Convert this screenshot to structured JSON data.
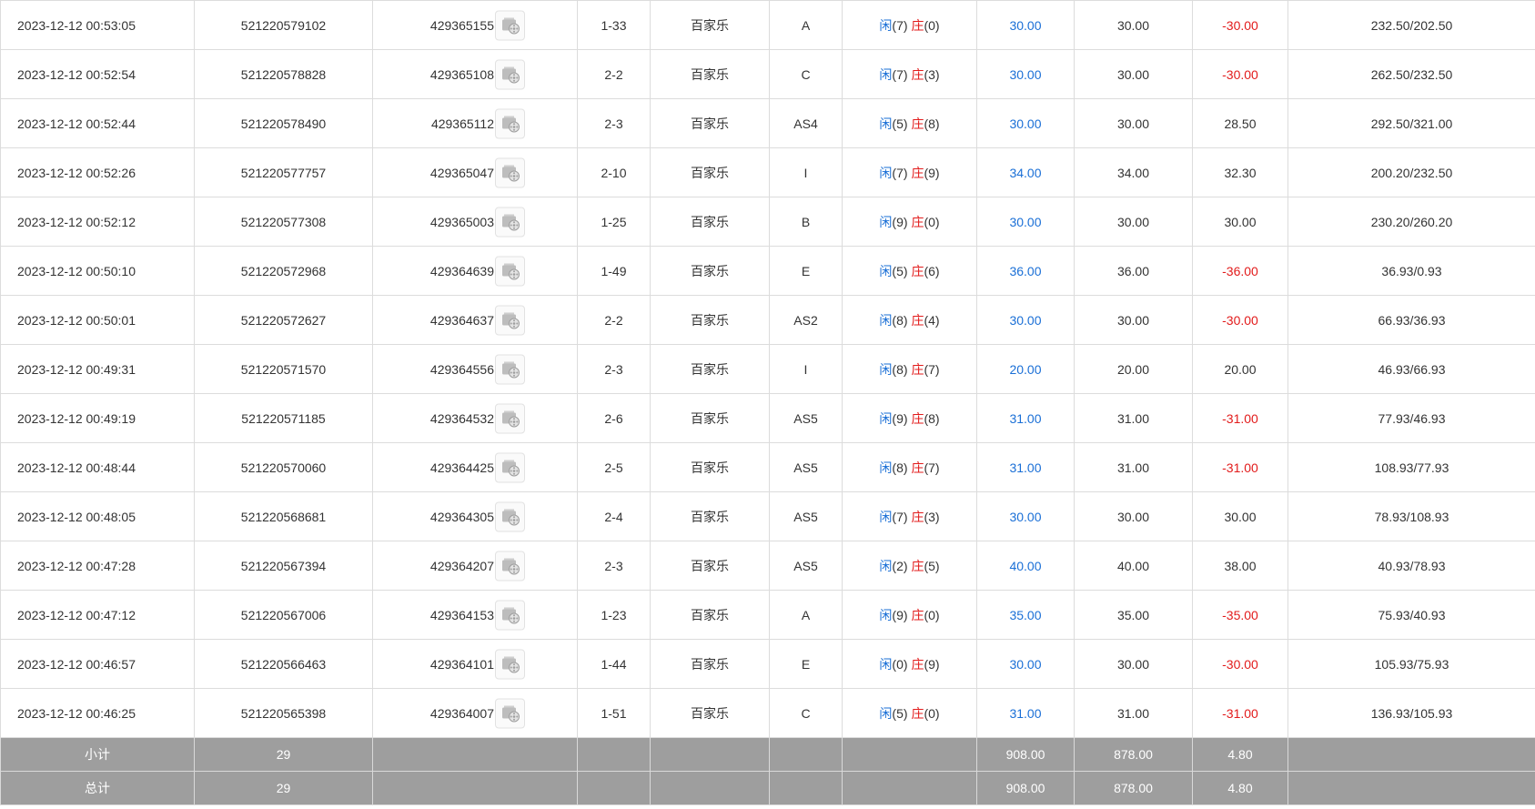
{
  "colors": {
    "blue": "#1a6fd6",
    "red": "#e21b1b",
    "summary_bg": "#9e9e9e"
  },
  "labels": {
    "player": "闲",
    "banker": "庄"
  },
  "rows": [
    {
      "time": "2023-12-12 00:53:05",
      "order": "521220579102",
      "round": "429365155",
      "shoe": "1-33",
      "game": "百家乐",
      "table": "A",
      "player": "7",
      "banker": "0",
      "bet": "30.00",
      "valid": "30.00",
      "win": "-30.00",
      "balance": "232.50/202.50"
    },
    {
      "time": "2023-12-12 00:52:54",
      "order": "521220578828",
      "round": "429365108",
      "shoe": "2-2",
      "game": "百家乐",
      "table": "C",
      "player": "7",
      "banker": "3",
      "bet": "30.00",
      "valid": "30.00",
      "win": "-30.00",
      "balance": "262.50/232.50"
    },
    {
      "time": "2023-12-12 00:52:44",
      "order": "521220578490",
      "round": "429365112",
      "shoe": "2-3",
      "game": "百家乐",
      "table": "AS4",
      "player": "5",
      "banker": "8",
      "bet": "30.00",
      "valid": "30.00",
      "win": "28.50",
      "balance": "292.50/321.00"
    },
    {
      "time": "2023-12-12 00:52:26",
      "order": "521220577757",
      "round": "429365047",
      "shoe": "2-10",
      "game": "百家乐",
      "table": "I",
      "player": "7",
      "banker": "9",
      "bet": "34.00",
      "valid": "34.00",
      "win": "32.30",
      "balance": "200.20/232.50"
    },
    {
      "time": "2023-12-12 00:52:12",
      "order": "521220577308",
      "round": "429365003",
      "shoe": "1-25",
      "game": "百家乐",
      "table": "B",
      "player": "9",
      "banker": "0",
      "bet": "30.00",
      "valid": "30.00",
      "win": "30.00",
      "balance": "230.20/260.20"
    },
    {
      "time": "2023-12-12 00:50:10",
      "order": "521220572968",
      "round": "429364639",
      "shoe": "1-49",
      "game": "百家乐",
      "table": "E",
      "player": "5",
      "banker": "6",
      "bet": "36.00",
      "valid": "36.00",
      "win": "-36.00",
      "balance": "36.93/0.93"
    },
    {
      "time": "2023-12-12 00:50:01",
      "order": "521220572627",
      "round": "429364637",
      "shoe": "2-2",
      "game": "百家乐",
      "table": "AS2",
      "player": "8",
      "banker": "4",
      "bet": "30.00",
      "valid": "30.00",
      "win": "-30.00",
      "balance": "66.93/36.93"
    },
    {
      "time": "2023-12-12 00:49:31",
      "order": "521220571570",
      "round": "429364556",
      "shoe": "2-3",
      "game": "百家乐",
      "table": "I",
      "player": "8",
      "banker": "7",
      "bet": "20.00",
      "valid": "20.00",
      "win": "20.00",
      "balance": "46.93/66.93"
    },
    {
      "time": "2023-12-12 00:49:19",
      "order": "521220571185",
      "round": "429364532",
      "shoe": "2-6",
      "game": "百家乐",
      "table": "AS5",
      "player": "9",
      "banker": "8",
      "bet": "31.00",
      "valid": "31.00",
      "win": "-31.00",
      "balance": "77.93/46.93"
    },
    {
      "time": "2023-12-12 00:48:44",
      "order": "521220570060",
      "round": "429364425",
      "shoe": "2-5",
      "game": "百家乐",
      "table": "AS5",
      "player": "8",
      "banker": "7",
      "bet": "31.00",
      "valid": "31.00",
      "win": "-31.00",
      "balance": "108.93/77.93"
    },
    {
      "time": "2023-12-12 00:48:05",
      "order": "521220568681",
      "round": "429364305",
      "shoe": "2-4",
      "game": "百家乐",
      "table": "AS5",
      "player": "7",
      "banker": "3",
      "bet": "30.00",
      "valid": "30.00",
      "win": "30.00",
      "balance": "78.93/108.93"
    },
    {
      "time": "2023-12-12 00:47:28",
      "order": "521220567394",
      "round": "429364207",
      "shoe": "2-3",
      "game": "百家乐",
      "table": "AS5",
      "player": "2",
      "banker": "5",
      "bet": "40.00",
      "valid": "40.00",
      "win": "38.00",
      "balance": "40.93/78.93"
    },
    {
      "time": "2023-12-12 00:47:12",
      "order": "521220567006",
      "round": "429364153",
      "shoe": "1-23",
      "game": "百家乐",
      "table": "A",
      "player": "9",
      "banker": "0",
      "bet": "35.00",
      "valid": "35.00",
      "win": "-35.00",
      "balance": "75.93/40.93"
    },
    {
      "time": "2023-12-12 00:46:57",
      "order": "521220566463",
      "round": "429364101",
      "shoe": "1-44",
      "game": "百家乐",
      "table": "E",
      "player": "0",
      "banker": "9",
      "bet": "30.00",
      "valid": "30.00",
      "win": "-30.00",
      "balance": "105.93/75.93"
    },
    {
      "time": "2023-12-12 00:46:25",
      "order": "521220565398",
      "round": "429364007",
      "shoe": "1-51",
      "game": "百家乐",
      "table": "C",
      "player": "5",
      "banker": "0",
      "bet": "31.00",
      "valid": "31.00",
      "win": "-31.00",
      "balance": "136.93/105.93"
    }
  ],
  "subtotal": {
    "label": "小计",
    "count": "29",
    "bet": "908.00",
    "valid": "878.00",
    "win": "4.80"
  },
  "total": {
    "label": "总计",
    "count": "29",
    "bet": "908.00",
    "valid": "878.00",
    "win": "4.80"
  }
}
